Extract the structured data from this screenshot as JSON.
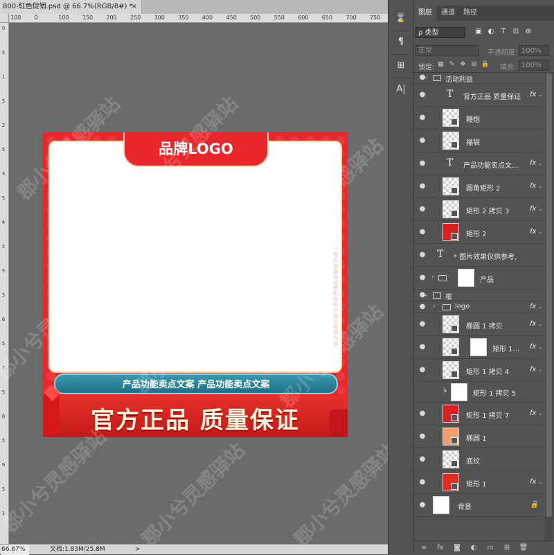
{
  "document": {
    "tab_title": "800-紅色促销.psd @ 66.7%(RGB/8#) *",
    "close_glyph": "×"
  },
  "ruler_top": [
    "100",
    "0",
    "100",
    "150",
    "200",
    "250",
    "300",
    "350",
    "400",
    "450",
    "500",
    "550",
    "600",
    "650",
    "700",
    "750",
    "800"
  ],
  "ruler_left": [
    "0",
    "5",
    "1",
    "5",
    "2",
    "5",
    "3",
    "5",
    "4",
    "5",
    "5",
    "5",
    "6",
    "5",
    "7",
    "5",
    "8",
    "5",
    "9",
    "5",
    "1"
  ],
  "artwork": {
    "logo_text": "品牌LOGO",
    "side_note": "*图片效果仅供参考，实际产品以收到为准",
    "feature_text": "产品功能卖点文案  产品功能卖点文案",
    "slogan_text": "官方正品  质量保证",
    "colors": {
      "primary_red": "#e8262b",
      "teal": "#2a87a0",
      "cream": "#fff5dc"
    }
  },
  "watermark": "郡小兮灵感驿站",
  "status": {
    "zoom": "66.67%",
    "doc_info": "文档:1.83M/25.8M",
    "arrow": ">"
  },
  "tools": [
    {
      "name": "history-icon",
      "glyph": "⌛"
    },
    {
      "name": "paragraph-icon",
      "glyph": "¶"
    },
    {
      "name": "properties-icon",
      "glyph": "⊞"
    },
    {
      "name": "character-icon",
      "glyph": "A|"
    }
  ],
  "layers_panel": {
    "tabs": [
      "图层",
      "通道",
      "路径"
    ],
    "filter_label": "ρ 类型",
    "filter_icons": [
      "▣",
      "◐",
      "T",
      "⊡",
      "⊕"
    ],
    "blend_mode": "正常",
    "opacity_label": "不透明度:",
    "opacity_value": "100%",
    "lock_label": "锁定:",
    "lock_icons": [
      "▦",
      "✎",
      "✥",
      "⊞",
      "🔒"
    ],
    "fill_label": "填充:",
    "fill_value": "100%",
    "layers": [
      {
        "kind": "group",
        "name": "活动利益",
        "indent": 0,
        "eye": "●",
        "expanded": true
      },
      {
        "kind": "text",
        "name": "官方正品 质量保证",
        "indent": 1,
        "eye": "●",
        "fx": "fx"
      },
      {
        "kind": "smart",
        "name": "鞭炮",
        "indent": 1,
        "eye": "●",
        "thumb_color": ""
      },
      {
        "kind": "smart",
        "name": "福袋",
        "indent": 1,
        "eye": "●",
        "thumb_color": ""
      },
      {
        "kind": "text",
        "name": "产品功能卖点文...",
        "indent": 1,
        "eye": "●",
        "fx": "fx"
      },
      {
        "kind": "smart",
        "name": "圆角矩形 2",
        "indent": 1,
        "eye": "●",
        "fx": "fx",
        "thumb_color": ""
      },
      {
        "kind": "smart",
        "name": "矩形 2 拷贝 3",
        "indent": 1,
        "eye": "●",
        "fx": "fx",
        "thumb_color": ""
      },
      {
        "kind": "smart",
        "name": "矩形 2",
        "indent": 1,
        "eye": "●",
        "fx": "fx",
        "thumb_color": "#d82020"
      },
      {
        "kind": "text",
        "name": "* 图片效果仅供参考,...",
        "indent": 0,
        "eye": "●"
      },
      {
        "kind": "group-mask",
        "name": "产品",
        "indent": 0,
        "eye": "●"
      },
      {
        "kind": "group",
        "name": "框",
        "indent": 0,
        "eye": "●",
        "expanded": true
      },
      {
        "kind": "subgroup",
        "name": "logo",
        "indent": 1,
        "eye": "●",
        "fx": "fx"
      },
      {
        "kind": "smart",
        "name": "椭圆 1 拷贝",
        "indent": 1,
        "eye": "●",
        "fx": "fx",
        "thumb_color": ""
      },
      {
        "kind": "masked",
        "name": "矩形 1...",
        "indent": 1,
        "eye": "●",
        "fx": "fx"
      },
      {
        "kind": "smart",
        "name": "矩形 1 拷贝 4",
        "indent": 1,
        "eye": "●",
        "fx": "fx",
        "thumb_color": ""
      },
      {
        "kind": "clip",
        "name": "矩形 1 拷贝 5",
        "indent": 1,
        "eye": ""
      },
      {
        "kind": "smart",
        "name": "矩形 1 拷贝 7",
        "indent": 1,
        "eye": "●",
        "fx": "fx",
        "thumb_color": "#d82020"
      },
      {
        "kind": "smart",
        "name": "椭圆 1",
        "indent": 1,
        "eye": "●",
        "thumb_color": "#f0a070"
      },
      {
        "kind": "smart",
        "name": "底纹",
        "indent": 1,
        "eye": "●",
        "thumb_color": ""
      },
      {
        "kind": "smart",
        "name": "矩形 1",
        "indent": 1,
        "eye": "●",
        "fx": "fx",
        "thumb_color": "#e02a22"
      },
      {
        "kind": "background",
        "name": "背景",
        "indent": 0,
        "eye": "●",
        "lock": "🔒"
      }
    ],
    "bottom_icons": [
      {
        "name": "link-layers-icon",
        "glyph": "∞"
      },
      {
        "name": "fx-icon",
        "glyph": "fx"
      },
      {
        "name": "mask-icon",
        "glyph": "◙"
      },
      {
        "name": "adjustment-icon",
        "glyph": "◐"
      },
      {
        "name": "new-group-icon",
        "glyph": "▭"
      },
      {
        "name": "new-layer-icon",
        "glyph": "⊞"
      },
      {
        "name": "delete-icon",
        "glyph": "🗑"
      }
    ]
  }
}
